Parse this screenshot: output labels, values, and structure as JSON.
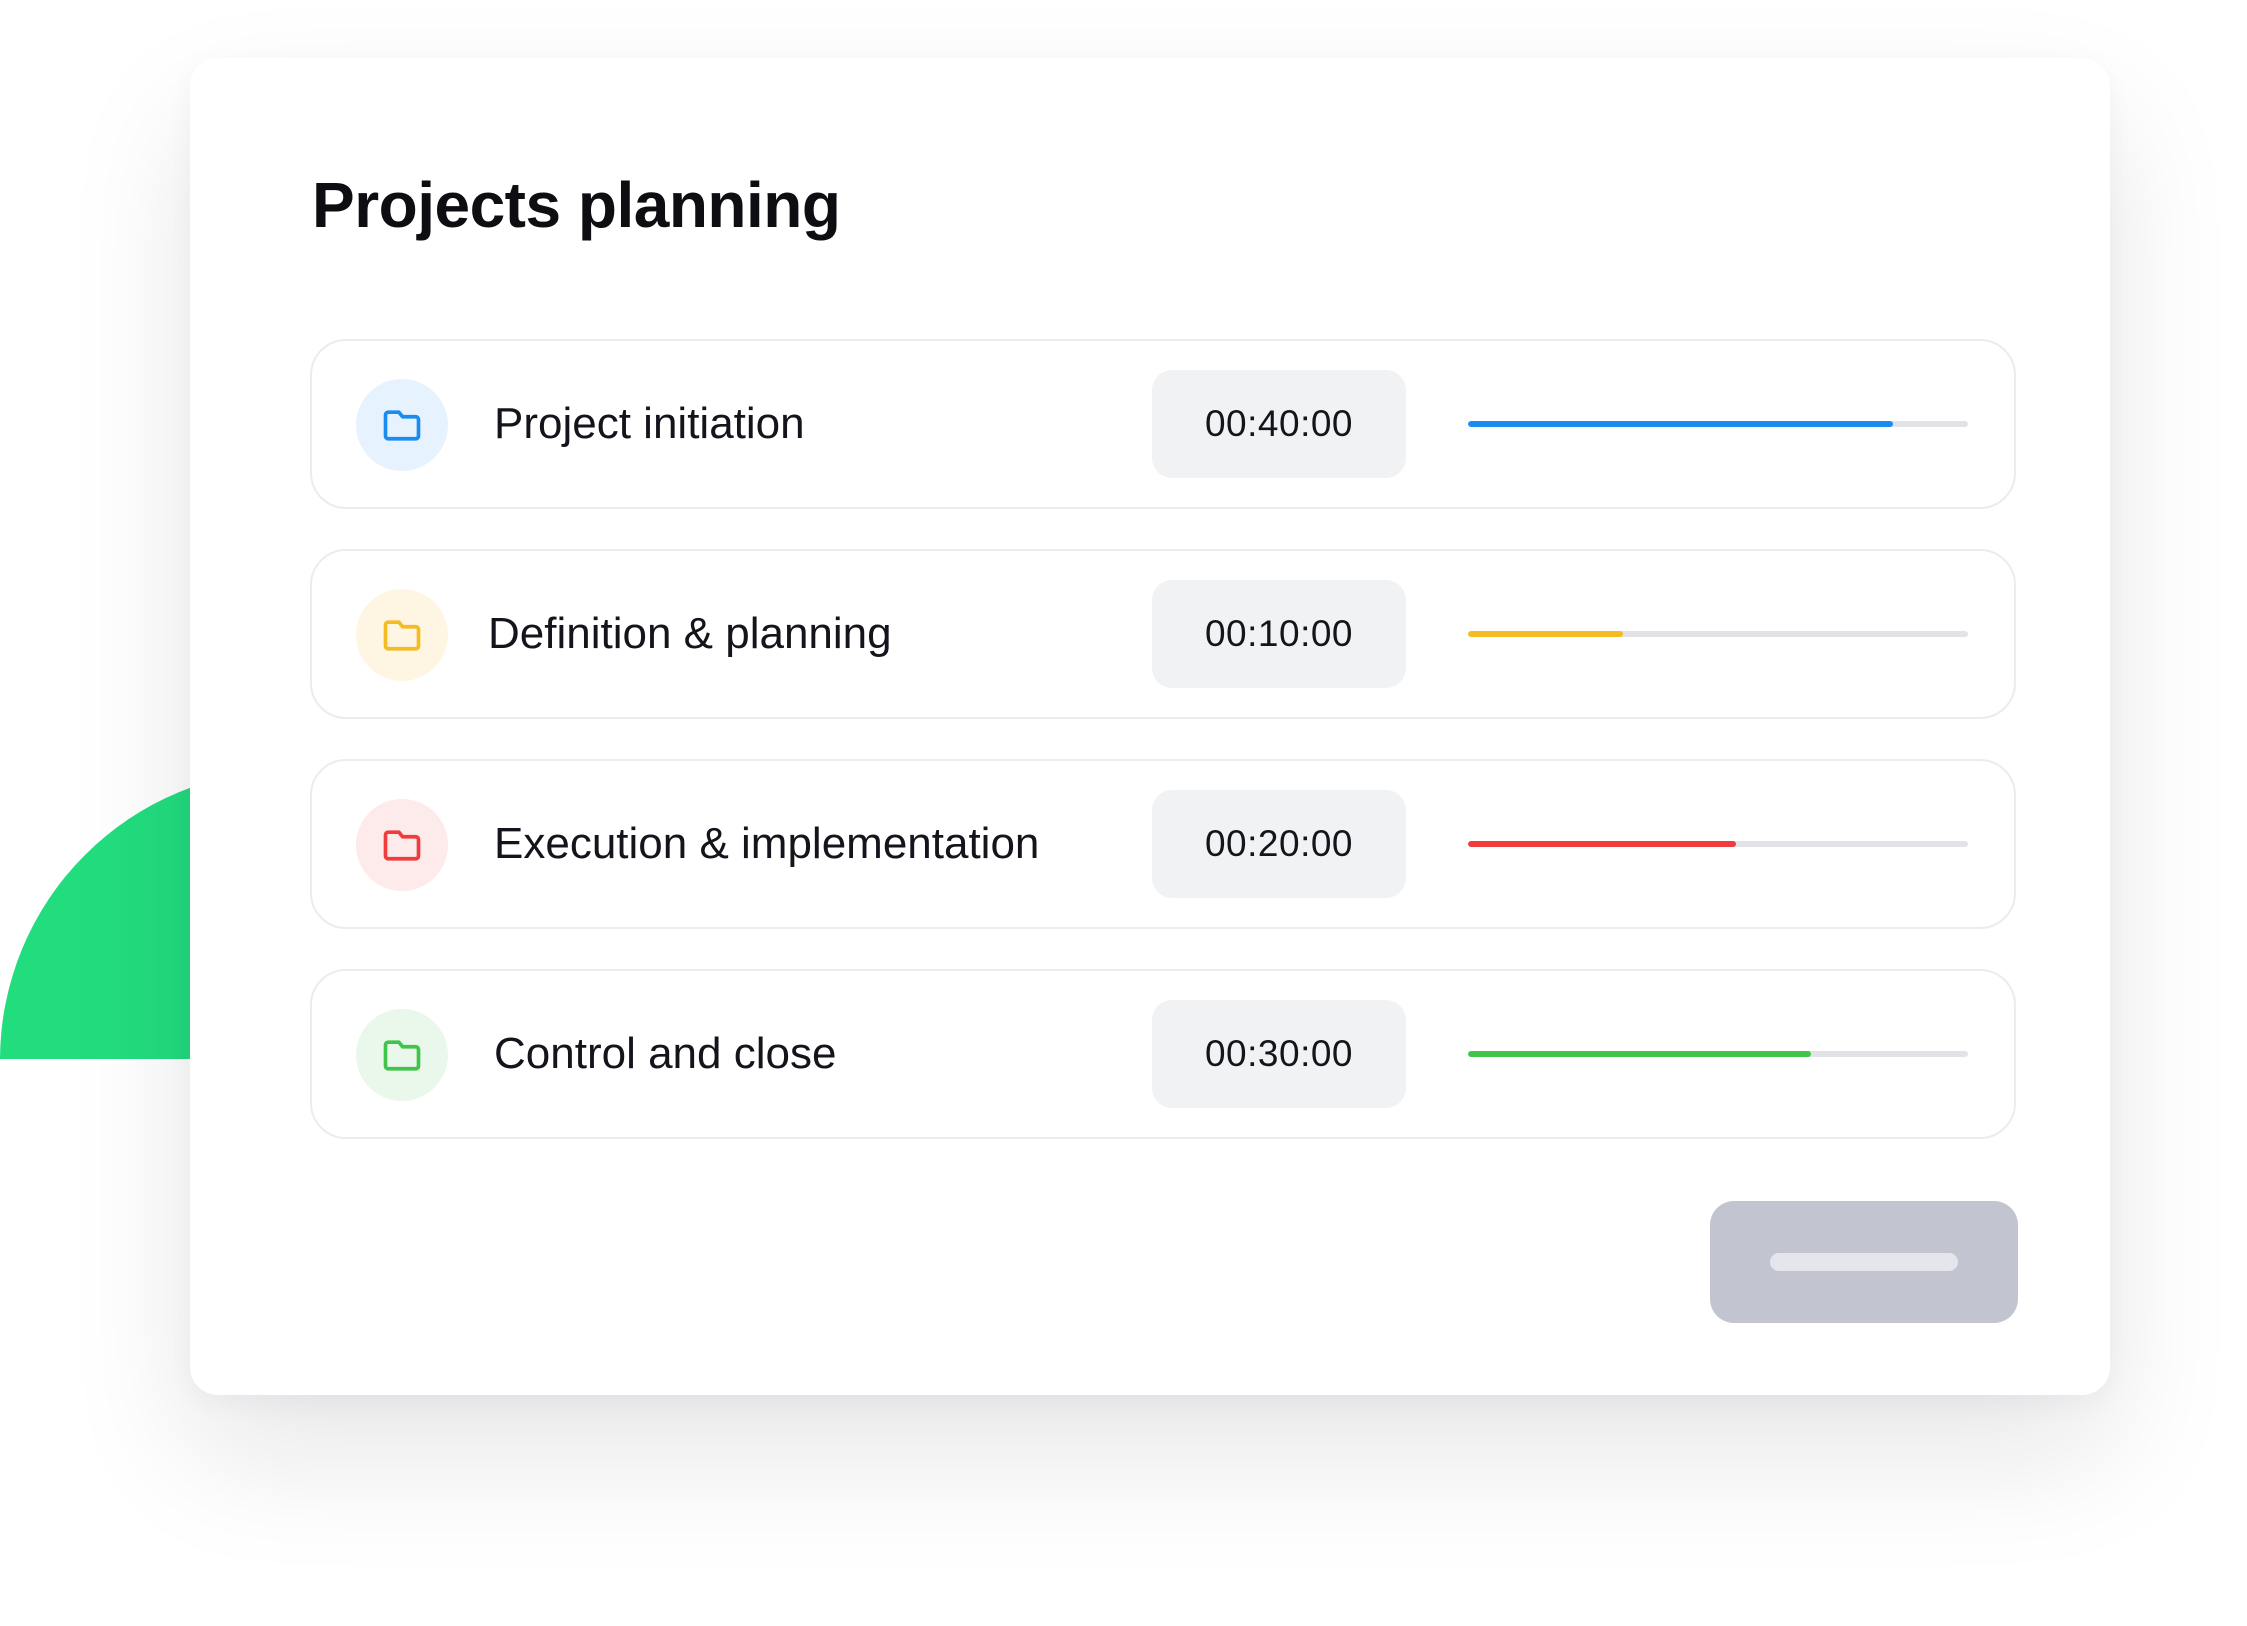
{
  "title": "Projects planning",
  "decoration_color": "#22dd7e",
  "rows": [
    {
      "label": "Project initiation",
      "time": "00:40:00",
      "progress": 0.85,
      "color": "#1a8cf0",
      "icon_bg": "#e6f2fd",
      "icon": "folder-icon"
    },
    {
      "label": "Definition & planning",
      "time": "00:10:00",
      "progress": 0.31,
      "color": "#f4bb22",
      "icon_bg": "#fef6e3",
      "icon": "folder-icon"
    },
    {
      "label": "Execution & implementation",
      "time": "00:20:00",
      "progress": 0.535,
      "color": "#ef3c3c",
      "icon_bg": "#fdeaea",
      "icon": "folder-icon"
    },
    {
      "label": "Control and close",
      "time": "00:30:00",
      "progress": 0.685,
      "color": "#40c44a",
      "icon_bg": "#eaf7eb",
      "icon": "folder-icon"
    }
  ],
  "action_button": {
    "label": ""
  }
}
